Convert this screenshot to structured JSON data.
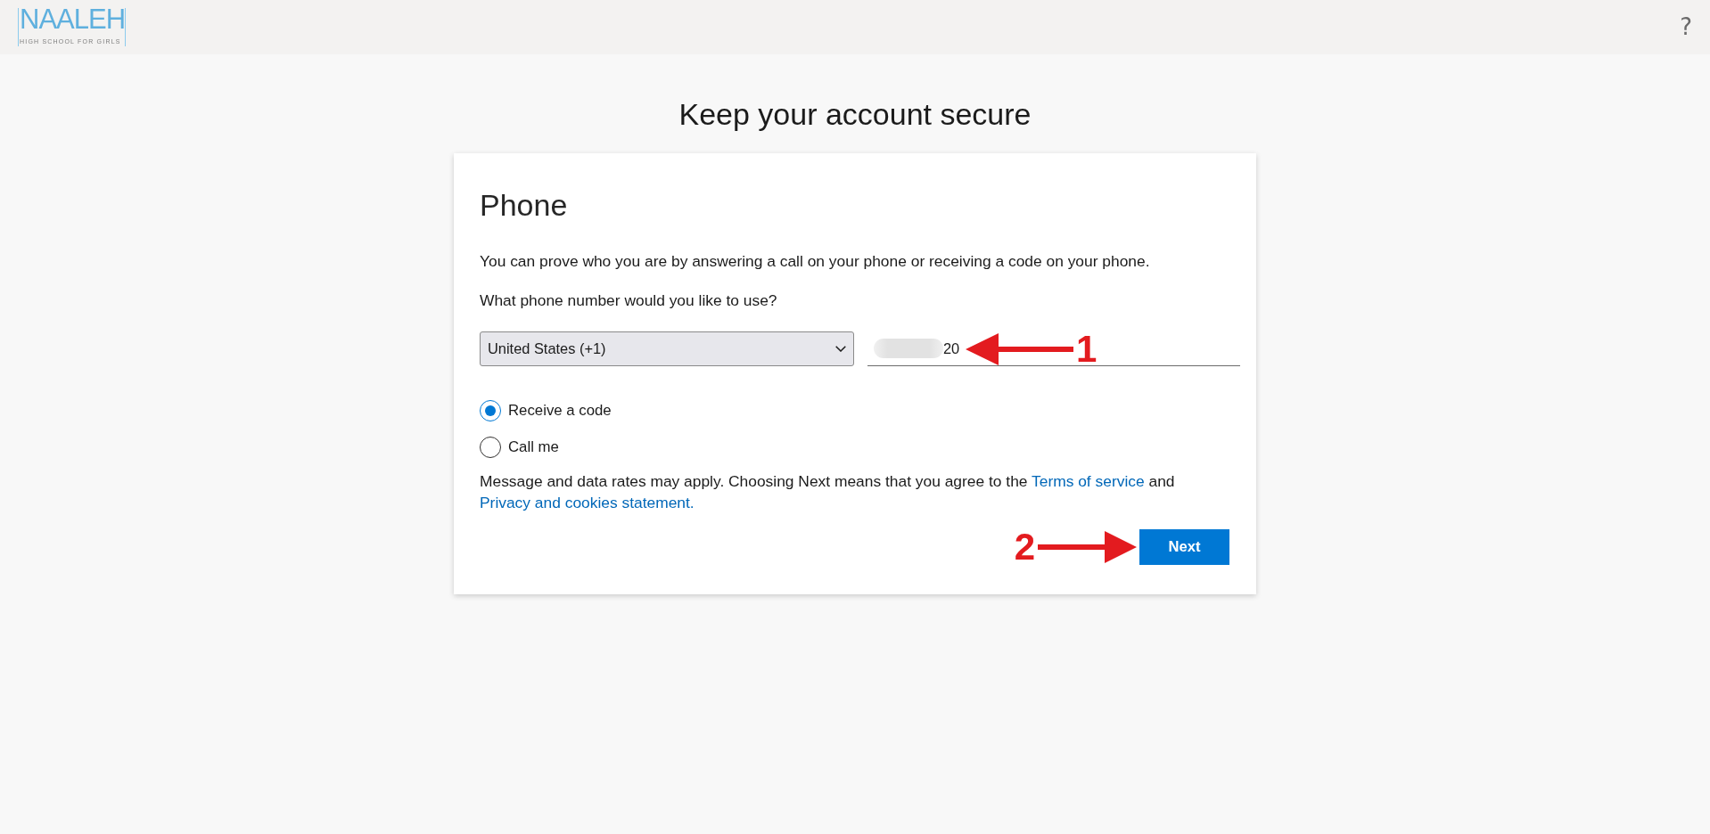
{
  "header": {
    "logo": {
      "name": "NAALEH",
      "tagline": "HIGH SCHOOL FOR GIRLS"
    },
    "help_icon": "?"
  },
  "title": "Keep your account secure",
  "card": {
    "heading": "Phone",
    "intro": "You can prove who you are by answering a call on your phone or receiving a code on your phone.",
    "question": "What phone number would you like to use?",
    "country_select": {
      "value": "United States (+1)"
    },
    "phone_field": {
      "value": "20"
    },
    "options": [
      {
        "label": "Receive a code",
        "selected": true
      },
      {
        "label": "Call me",
        "selected": false
      }
    ],
    "disclaimer": [
      {
        "kind": "text",
        "text": "Message and data rates may apply. Choosing Next means that you agree to the "
      },
      {
        "kind": "link",
        "text": "Terms of service"
      },
      {
        "kind": "text",
        "text": " and "
      },
      {
        "kind": "link",
        "text": "Privacy and cookies statement."
      }
    ],
    "next_button": "Next"
  },
  "annotations": [
    {
      "label": "1"
    },
    {
      "label": "2"
    }
  ]
}
